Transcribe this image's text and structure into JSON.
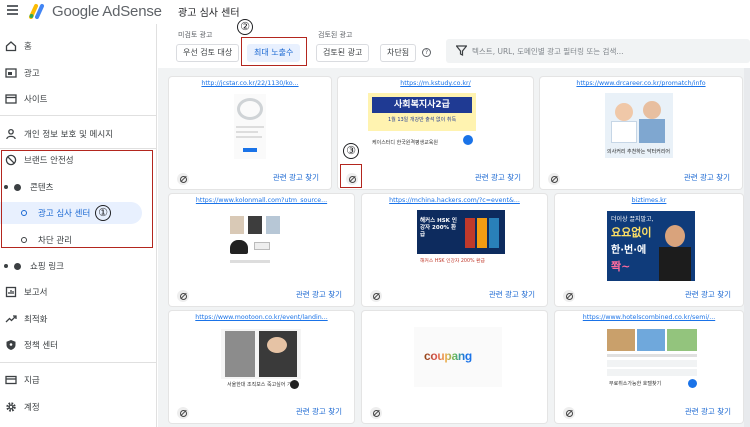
{
  "header": {
    "app_name": "Google AdSense",
    "page_title": "광고 심사 센터"
  },
  "sidebar": {
    "items": [
      {
        "label": "홈"
      },
      {
        "label": "광고"
      },
      {
        "label": "사이트"
      },
      {
        "label": "개인 정보 보호 및 메시지"
      },
      {
        "label": "브랜드 안전성"
      },
      {
        "label": "콘텐츠"
      },
      {
        "label": "광고 심사 센터"
      },
      {
        "label": "차단 관리"
      },
      {
        "label": "쇼핑 링크"
      },
      {
        "label": "보고서"
      },
      {
        "label": "최적화"
      },
      {
        "label": "정책 센터"
      },
      {
        "label": "지급"
      },
      {
        "label": "계정"
      }
    ]
  },
  "annotations": [
    "①",
    "②",
    "③"
  ],
  "filters": {
    "unreviewed_label": "미검토 광고",
    "unreviewed_chips": [
      "우선 검토 대상",
      "최대 노출수"
    ],
    "reviewed_label": "검토된 광고",
    "reviewed_chips": [
      "검토된 광고",
      "차단됨"
    ],
    "help_icon_text": "?",
    "search_placeholder": "텍스트, URL, 도메인별 광고 필터링 또는 검색..."
  },
  "cards": [
    {
      "url": "http://jcstar.co.kr/22/1130/ko...",
      "related": "관련 광고 찾기"
    },
    {
      "url": "https://m.kstudy.co.kr/",
      "related": "관련 광고 찾기",
      "creative": {
        "headline": "사회복지사2급",
        "sub": "1월 13일 개강반 출석 없이 취득",
        "footer": "케이스터디 한국원격평생교육원"
      }
    },
    {
      "url": "https://www.drcareer.co.kr/promatch/info",
      "related": "관련 광고 찾기",
      "creative": {
        "caption": "의사커리 추천하는 닥터커리어"
      }
    },
    {
      "url": "https://www.kolonmall.com?utm_source...",
      "related": "관련 광고 찾기"
    },
    {
      "url": "https://mchina.hackers.com/?c=event&...",
      "related": "관련 광고 찾기",
      "creative": {
        "headline": "해커스 HSK 인강자 200% 환급",
        "footer": "해커스 HSK 인강자 200% 환급"
      }
    },
    {
      "url": "biztimes.kr",
      "related": "관련 광고 찾기",
      "creative": {
        "line1": "더이상 끌지말고,",
        "line2": "요요없이",
        "line3": "한·번·에",
        "line4": "쫙~"
      }
    },
    {
      "url": "https://www.mootoon.co.kr/event/landin...",
      "related": "관련 광고 찾기",
      "creative": {
        "footer": "서울한대 조직보스 죽고싶어 가다"
      }
    },
    {
      "url": "",
      "related": "",
      "creative": {
        "brand": "coupang"
      }
    },
    {
      "url": "https://www.hotelscombined.co.kr/semi/...",
      "related": "관련 광고 찾기",
      "creative": {
        "footer": "무료취소가능한 호텔찾기"
      }
    }
  ],
  "colors": {
    "accent": "#1a73e8",
    "annotation_red": "#b3261e",
    "selected_bg": "#e8f0fe"
  }
}
